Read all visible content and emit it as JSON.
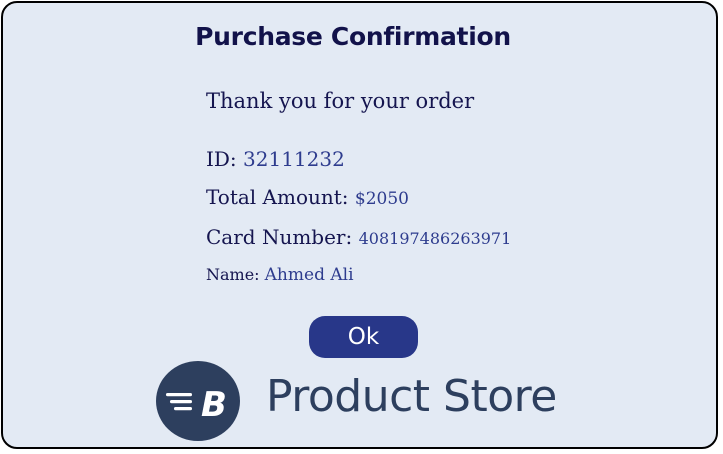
{
  "dialog": {
    "title": "Purchase Confirmation",
    "message": "Thank you for your order",
    "fields": {
      "id": {
        "label": "ID: ",
        "value": "32111232"
      },
      "total": {
        "label": "Total Amount: ",
        "value": "$2050"
      },
      "card": {
        "label": "Card Number: ",
        "value": "408197486263971"
      },
      "name": {
        "label": "Name: ",
        "value": "Ahmed Ali"
      }
    },
    "ok_label": "Ok"
  },
  "brand": {
    "logo_icon": "speed-b-logo-icon",
    "logo_letter": "B",
    "name": "Product Store",
    "color": "#2d3f5e"
  },
  "colors": {
    "background": "#e3eaf4",
    "accent": "#283789",
    "heading": "#12124a",
    "value": "#2e3c8e"
  }
}
